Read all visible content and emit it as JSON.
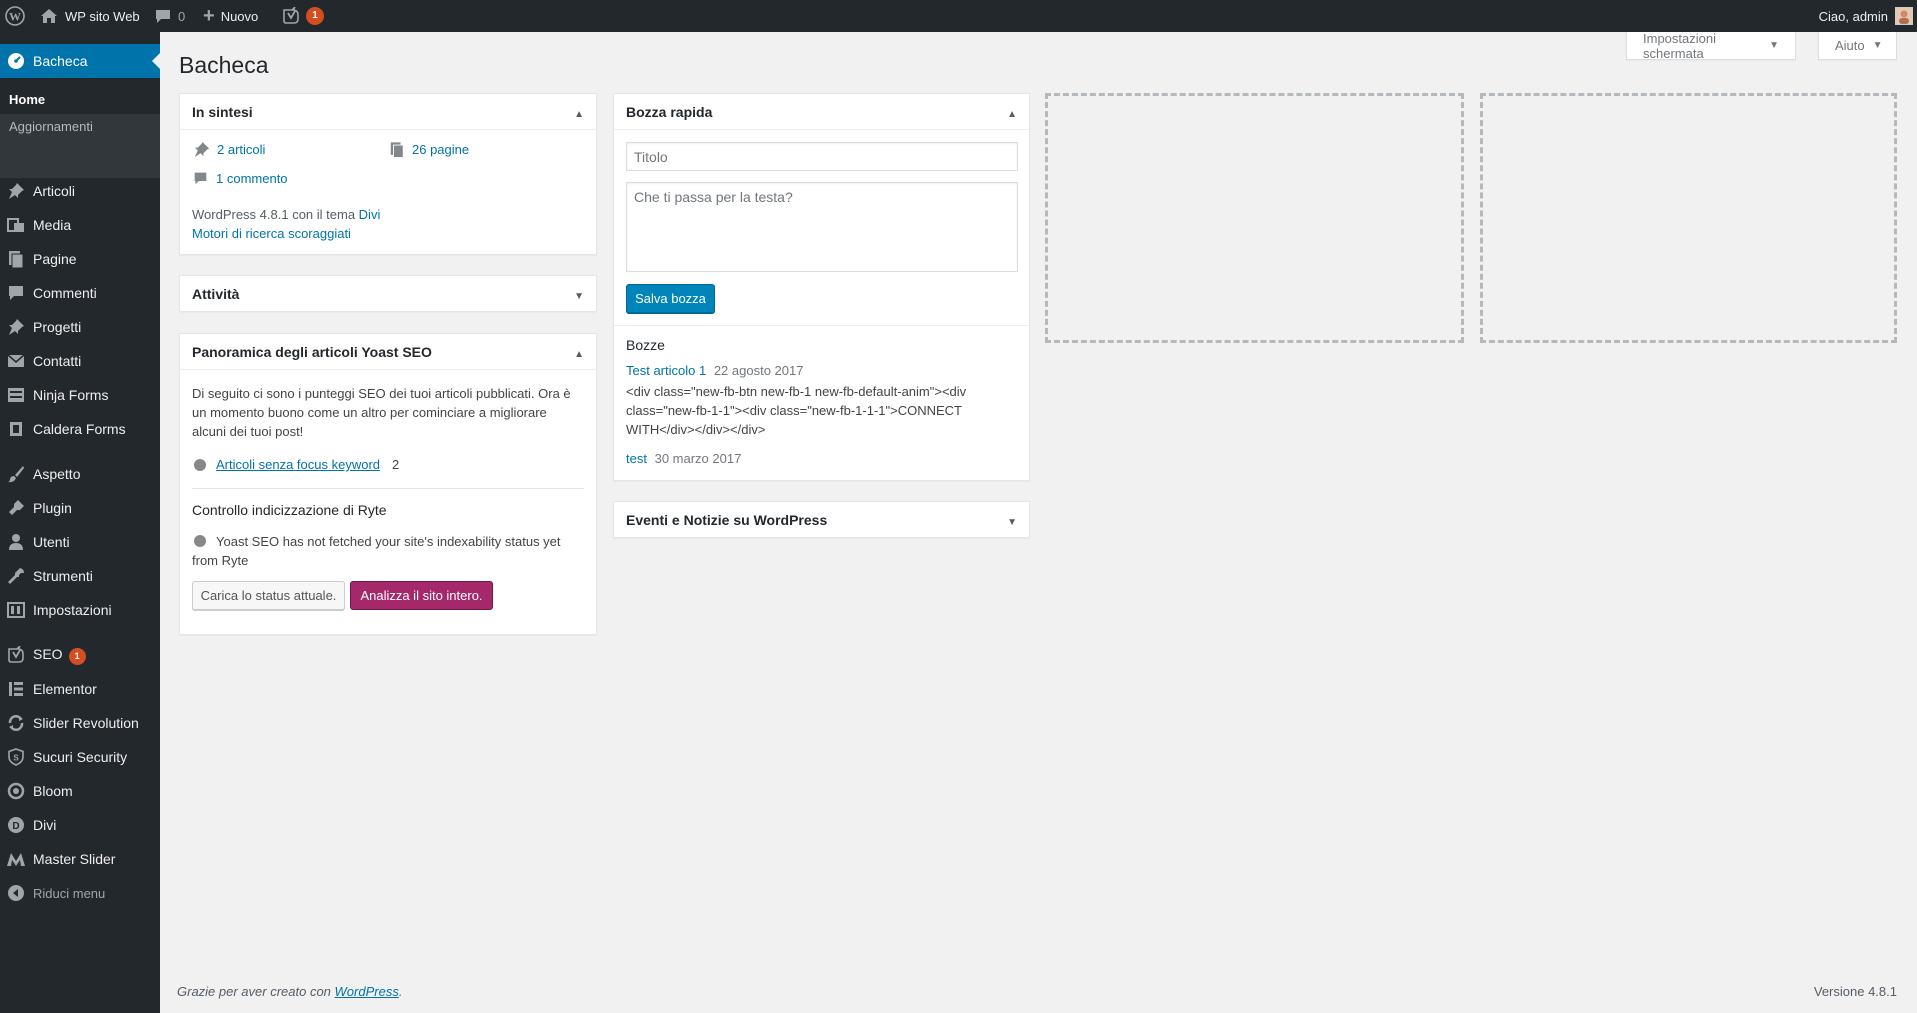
{
  "adminbar": {
    "site_name": "WP sito Web",
    "comments_count": "0",
    "new_label": "Nuovo",
    "yoast_count": "1",
    "greeting": "Ciao, admin"
  },
  "sidebar": {
    "items": [
      {
        "label": "Bacheca",
        "icon": "dashboard-icon"
      },
      {
        "label": "Articoli",
        "icon": "pin-icon"
      },
      {
        "label": "Media",
        "icon": "media-icon"
      },
      {
        "label": "Pagine",
        "icon": "pages-icon"
      },
      {
        "label": "Commenti",
        "icon": "comments-icon"
      },
      {
        "label": "Progetti",
        "icon": "pin-icon"
      },
      {
        "label": "Contatti",
        "icon": "mail-icon"
      },
      {
        "label": "Ninja Forms",
        "icon": "form-icon"
      },
      {
        "label": "Caldera Forms",
        "icon": "caldera-icon"
      },
      {
        "label": "Aspetto",
        "icon": "brush-icon"
      },
      {
        "label": "Plugin",
        "icon": "plugin-icon"
      },
      {
        "label": "Utenti",
        "icon": "users-icon"
      },
      {
        "label": "Strumenti",
        "icon": "wrench-icon"
      },
      {
        "label": "Impostazioni",
        "icon": "settings-icon"
      },
      {
        "label": "SEO",
        "icon": "yoast-icon",
        "badge": "1"
      },
      {
        "label": "Elementor",
        "icon": "elementor-icon"
      },
      {
        "label": "Slider Revolution",
        "icon": "refresh-icon"
      },
      {
        "label": "Sucuri Security",
        "icon": "shield-icon"
      },
      {
        "label": "Bloom",
        "icon": "bloom-icon"
      },
      {
        "label": "Divi",
        "icon": "divi-icon"
      },
      {
        "label": "Master Slider",
        "icon": "master-slider-icon"
      },
      {
        "label": "Riduci menu",
        "icon": "collapse-icon"
      }
    ],
    "submenu": [
      "Home",
      "Aggiornamenti"
    ]
  },
  "page": {
    "title": "Bacheca",
    "screen_options": "Impostazioni schermata",
    "help": "Aiuto"
  },
  "glance": {
    "title": "In sintesi",
    "posts": "2 articoli",
    "pages": "26 pagine",
    "comments": "1 commento",
    "wp_version_text": "WordPress 4.8.1 con il tema ",
    "theme": "Divi",
    "search_engines": "Motori di ricerca scoraggiati"
  },
  "activity": {
    "title": "Attività"
  },
  "yoast": {
    "title": "Panoramica degli articoli Yoast SEO",
    "intro": "Di seguito ci sono i punteggi SEO dei tuoi articoli pubblicati. Ora è un momento buono come un altro per cominciare a migliorare alcuni dei tuoi post!",
    "no_focus_link": "Articoli senza focus keyword",
    "no_focus_count": "2",
    "ryte_title": "Controllo indicizzazione di Ryte",
    "ryte_status": "Yoast SEO has not fetched your site's indexability status yet from Ryte",
    "load_button": "Carica lo status attuale.",
    "analyze_button": "Analizza il sito intero."
  },
  "quick_draft": {
    "title": "Bozza rapida",
    "title_placeholder": "Titolo",
    "content_placeholder": "Che ti passa per la testa?",
    "save_button": "Salva bozza",
    "drafts_heading": "Bozze",
    "drafts": [
      {
        "title": "Test articolo 1",
        "date": "22 agosto 2017",
        "excerpt_lines": [
          "<div class=\"new-fb-btn new-fb-1 new-fb-default-anim\"><div",
          "class=\"new-fb-1-1\"><div class=\"new-fb-1-1-1\">CONNECT",
          "WITH</div></div></div>"
        ]
      },
      {
        "title": "test",
        "date": "30 marzo 2017"
      }
    ]
  },
  "events": {
    "title": "Eventi e Notizie su WordPress"
  },
  "footer": {
    "thanks_prefix": "Grazie per aver creato con ",
    "wordpress_link": "WordPress",
    "thanks_suffix": ".",
    "version": "Versione 4.8.1"
  }
}
